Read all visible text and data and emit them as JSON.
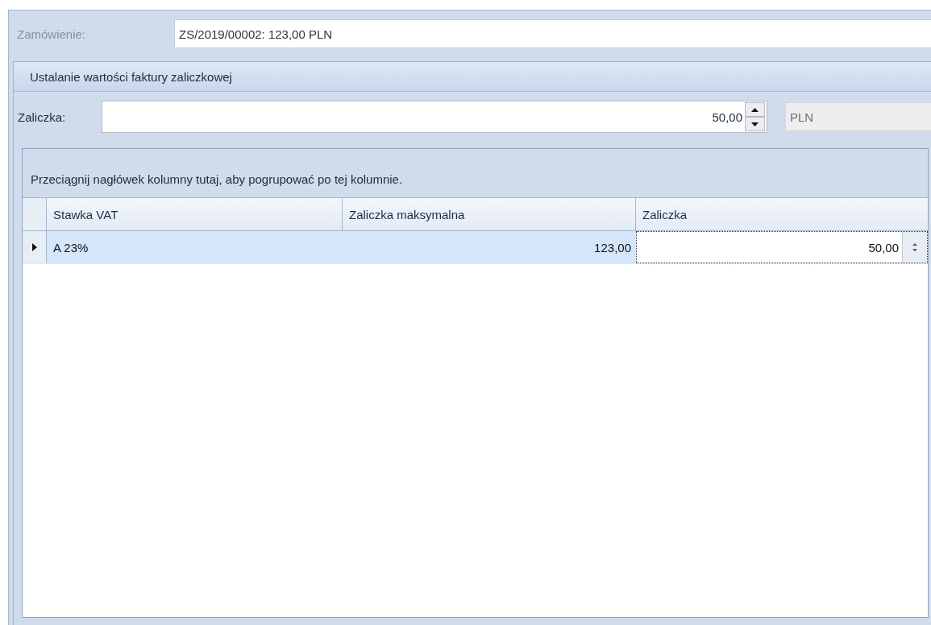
{
  "order": {
    "label": "Zamówienie:",
    "value": "ZS/2019/00002: 123,00 PLN",
    "disabled": true
  },
  "group": {
    "title": "Ustalanie wartości faktury zaliczkowej",
    "advance": {
      "label": "Zaliczka:",
      "value": "50,00",
      "currency": "PLN"
    },
    "grid": {
      "group_panel": "Przeciągnij nagłówek kolumny tutaj, aby pogrupować po tej kolumnie.",
      "columns": [
        "Stawka VAT",
        "Zaliczka maksymalna",
        "Zaliczka"
      ],
      "rows": [
        {
          "cells": [
            "A 23%",
            "123,00",
            "50,00"
          ],
          "selected": true
        }
      ]
    }
  }
}
